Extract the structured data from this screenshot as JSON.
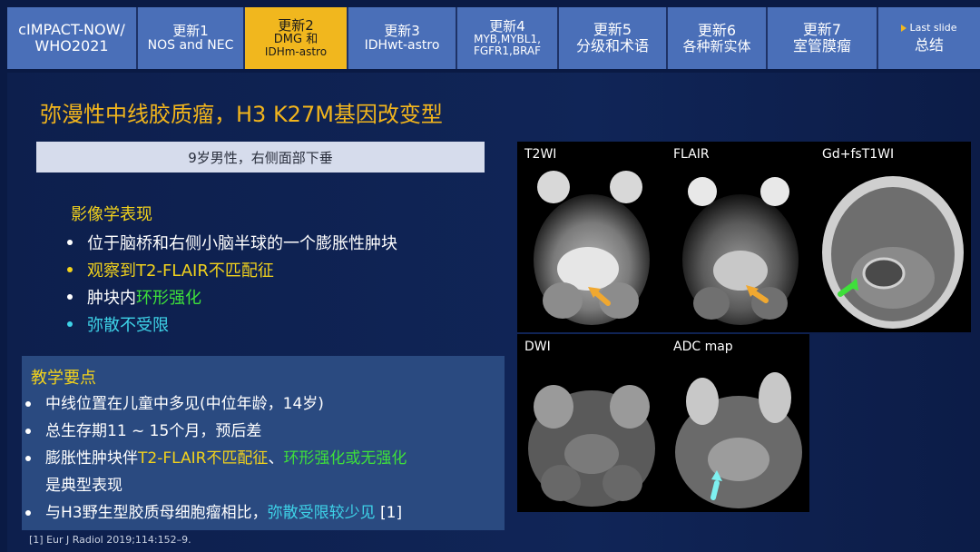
{
  "nav": {
    "tabs": [
      {
        "line1": "cIMPACT-NOW/",
        "line2": "WHO2021"
      },
      {
        "line1": "更新1",
        "line2": "NOS and NEC"
      },
      {
        "line1": "更新2",
        "line2": "DMG 和",
        "line3": "IDHm-astro"
      },
      {
        "line1": "更新3",
        "line2": "IDHwt-astro"
      },
      {
        "line1": "更新4",
        "line2": "MYB,MYBL1,",
        "line3": "FGFR1,BRAF"
      },
      {
        "line1": "更新5",
        "line2": "分级和术语"
      },
      {
        "line1": "更新6",
        "line2": "各种新实体"
      },
      {
        "line1": "更新7",
        "line2": "室管膜瘤"
      },
      {
        "last_slide": "Last slide",
        "line2": "总结"
      }
    ]
  },
  "slide": {
    "title": "弥漫性中线胶质瘤，H3 K27M基因改变型",
    "case": "9岁男性，右侧面部下垂",
    "findings_heading": "影像学表现",
    "findings": [
      "位于脑桥和右侧小脑半球的一个膨胀性肿块",
      "观察到T2-FLAIR不匹配征",
      "肿块内",
      "环形强化",
      "弥散不受限"
    ],
    "teaching_heading": "教学要点",
    "teaching": {
      "p1": "中线位置在儿童中多见(中位年龄，14岁)",
      "p2": "总生存期11 ~ 15个月，预后差",
      "p3a": "膨胀性肿块伴",
      "p3b": "T2-FLAIR不匹配征",
      "p3c": "、",
      "p3d": "环形强化或无强化",
      "p3e": "是典型表现",
      "p4a": "与H3野生型胶质母细胞瘤相比，",
      "p4b": "弥散受限较少见",
      "p4c": " [1]"
    },
    "reference": "[1] Eur J Radiol 2019;114:152–9."
  },
  "images": [
    {
      "label": "T2WI"
    },
    {
      "label": "FLAIR"
    },
    {
      "label": "Gd+fsT1WI"
    },
    {
      "label": "DWI"
    },
    {
      "label": "ADC map"
    }
  ],
  "colors": {
    "accent_yellow": "#f2d21c",
    "title_orange": "#f2b51c",
    "green": "#3ee03a",
    "cyan": "#3ed3e8",
    "active_tab": "#f1b71e",
    "tab": "#4a6fb8"
  }
}
